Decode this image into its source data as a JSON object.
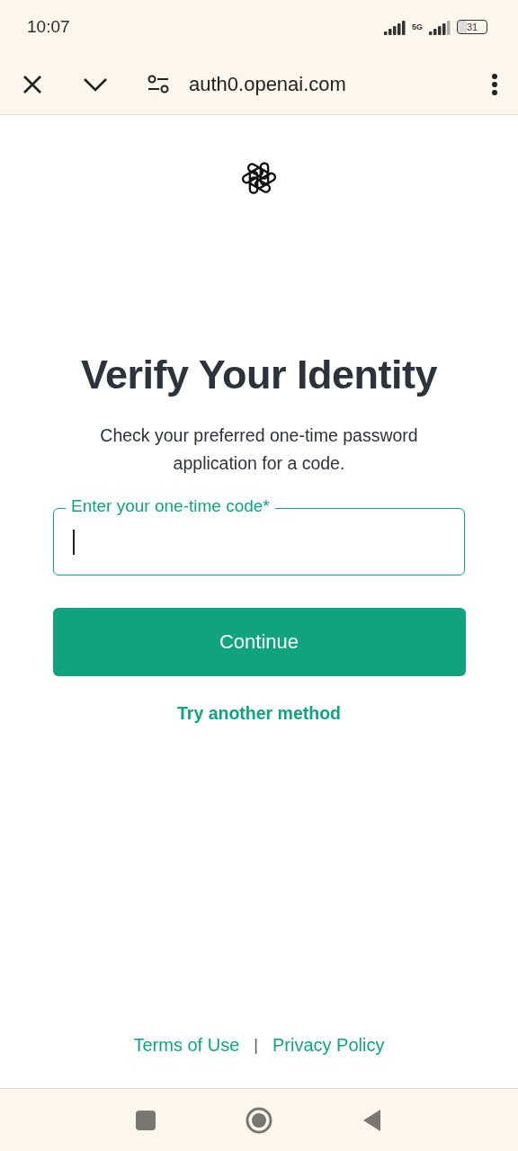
{
  "status_bar": {
    "time": "10:07",
    "network": "5G",
    "battery": "31"
  },
  "browser_toolbar": {
    "url": "auth0.openai.com"
  },
  "title": "Verify Your Identity",
  "subtitle": "Check your preferred one-time password application for a code.",
  "code_field": {
    "label": "Enter your one-time code*",
    "focused": true
  },
  "continue_button": "Continue",
  "alternate_link": "Try another method",
  "footer": {
    "links": [
      "Terms of Use",
      "Privacy Policy"
    ],
    "separator": "|"
  }
}
